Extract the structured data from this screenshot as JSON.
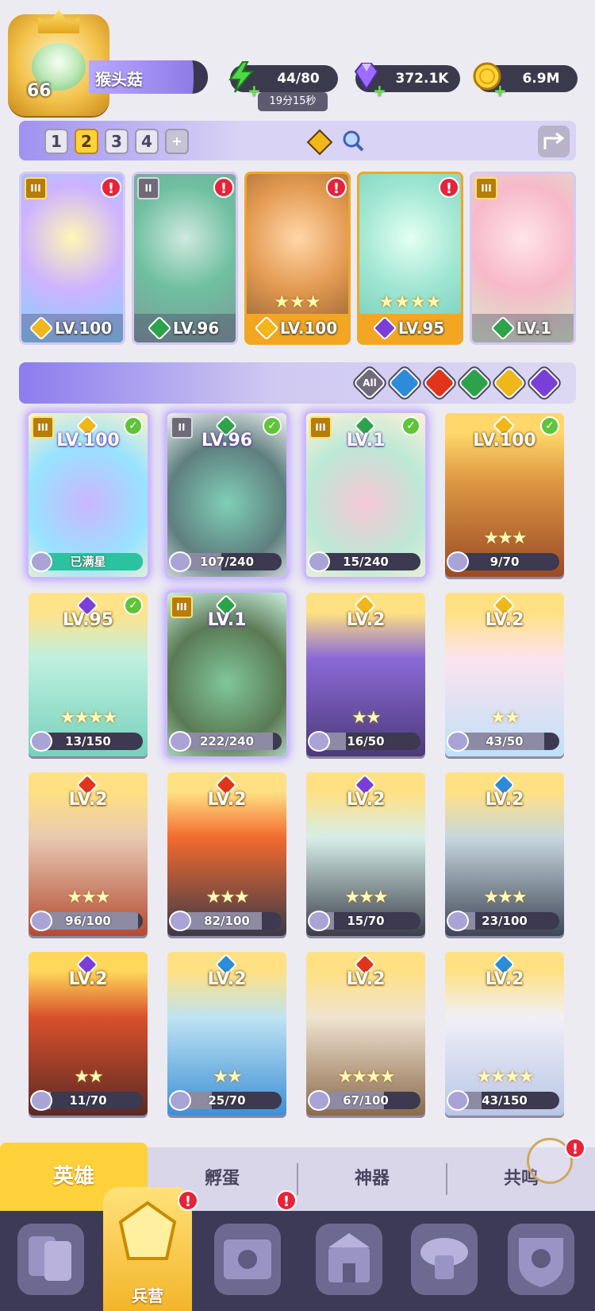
{
  "player": {
    "level": "66",
    "name": "猴头菇"
  },
  "resources": {
    "energy": "44/80",
    "energy_timer": "19分15秒",
    "gems": "372.1K",
    "gold": "6.9M"
  },
  "team_tabs": [
    "1",
    "2",
    "3",
    "4",
    "+"
  ],
  "team": [
    {
      "level": "LV.100",
      "element": "light",
      "rank": "III",
      "stars": "",
      "alert": "!",
      "art": [
        "#fff6b6",
        "#cdb3ff",
        "#7fd1ff"
      ]
    },
    {
      "level": "LV.96",
      "element": "wind",
      "rank": "II",
      "stars": "",
      "alert": "!",
      "art": [
        "#cfe9e0",
        "#6fbfa0",
        "#7e9a9a"
      ]
    },
    {
      "level": "LV.100",
      "element": "light",
      "rank": "",
      "stars": "★★★",
      "alert": "!",
      "art": [
        "#ffd7a8",
        "#e39a52",
        "#8a5a2f"
      ]
    },
    {
      "level": "LV.95",
      "element": "dark",
      "rank": "",
      "stars": "★★★★",
      "alert": "!",
      "art": [
        "#e4fff2",
        "#9fe6d2",
        "#6fc9b7"
      ]
    },
    {
      "level": "LV.1",
      "element": "wind",
      "rank": "III",
      "stars": "",
      "alert": "",
      "art": [
        "#ffe4ea",
        "#f7b9c9",
        "#d5eec9"
      ]
    }
  ],
  "filters": [
    "All",
    "water",
    "fire",
    "wind",
    "light",
    "dark"
  ],
  "filters_all_label": "All",
  "heroes": [
    {
      "level": "LV.100",
      "element": "light",
      "rank": "III",
      "checked": true,
      "stars": "",
      "progress": "已满星",
      "fill": 1.0,
      "full": true,
      "selected": true,
      "art": [
        "#fff3c7",
        "#cbb6ff",
        "#98e3ff"
      ]
    },
    {
      "level": "LV.96",
      "element": "wind",
      "rank": "II",
      "checked": true,
      "stars": "",
      "progress": "107/240",
      "fill": 0.45,
      "full": false,
      "selected": true,
      "art": [
        "#f2f2f2",
        "#7fcfb6",
        "#5f7f7f"
      ]
    },
    {
      "level": "LV.1",
      "element": "wind",
      "rank": "III",
      "checked": true,
      "stars": "",
      "progress": "15/240",
      "fill": 0.06,
      "full": false,
      "selected": true,
      "art": [
        "#fff0d8",
        "#f7c7d8",
        "#bce9d6"
      ]
    },
    {
      "level": "LV.100",
      "element": "light",
      "rank": "",
      "checked": true,
      "stars": "★★★",
      "progress": "9/70",
      "fill": 0.13,
      "full": false,
      "selected": false,
      "art": [
        "#ffd76a",
        "#e09a45",
        "#9a4a25"
      ]
    },
    {
      "level": "LV.95",
      "element": "dark",
      "rank": "",
      "checked": true,
      "stars": "★★★★",
      "progress": "13/150",
      "fill": 0.09,
      "full": false,
      "selected": false,
      "art": [
        "#ffe38a",
        "#bff0df",
        "#76d1bc"
      ]
    },
    {
      "level": "LV.1",
      "element": "wind",
      "rank": "III",
      "checked": false,
      "stars": "",
      "progress": "222/240",
      "fill": 0.92,
      "full": false,
      "selected": true,
      "art": [
        "#c9f1e0",
        "#7fc79a",
        "#5b7a54"
      ]
    },
    {
      "level": "LV.2",
      "element": "light",
      "rank": "",
      "checked": false,
      "stars": "★★",
      "progress": "16/50",
      "fill": 0.32,
      "full": false,
      "selected": false,
      "art": [
        "#ffe184",
        "#8b6ad6",
        "#4b3a7a"
      ]
    },
    {
      "level": "LV.2",
      "element": "light",
      "rank": "",
      "checked": false,
      "stars": "★★",
      "progress": "43/50",
      "fill": 0.86,
      "full": false,
      "selected": false,
      "art": [
        "#ffe184",
        "#fde3ef",
        "#bfe0f7"
      ]
    },
    {
      "level": "LV.2",
      "element": "fire",
      "rank": "",
      "checked": false,
      "stars": "★★★",
      "progress": "96/100",
      "fill": 0.96,
      "full": false,
      "selected": false,
      "art": [
        "#ffe184",
        "#e8c9b0",
        "#b44a34"
      ]
    },
    {
      "level": "LV.2",
      "element": "fire",
      "rank": "",
      "checked": false,
      "stars": "★★★",
      "progress": "82/100",
      "fill": 0.82,
      "full": false,
      "selected": false,
      "art": [
        "#ffe184",
        "#f26a2e",
        "#3a3a4a"
      ]
    },
    {
      "level": "LV.2",
      "element": "dark",
      "rank": "",
      "checked": false,
      "stars": "★★★",
      "progress": "15/70",
      "fill": 0.21,
      "full": false,
      "selected": false,
      "art": [
        "#ffe184",
        "#d6eee8",
        "#3a3d4a"
      ]
    },
    {
      "level": "LV.2",
      "element": "water",
      "rank": "",
      "checked": false,
      "stars": "★★★",
      "progress": "23/100",
      "fill": 0.23,
      "full": false,
      "selected": false,
      "art": [
        "#ffe184",
        "#c7d6de",
        "#3e4656"
      ]
    },
    {
      "level": "LV.2",
      "element": "dark",
      "rank": "",
      "checked": false,
      "stars": "★★",
      "progress": "11/70",
      "fill": 0.16,
      "full": false,
      "selected": false,
      "art": [
        "#ffd75a",
        "#d9502c",
        "#5a2a24"
      ]
    },
    {
      "level": "LV.2",
      "element": "water",
      "rank": "",
      "checked": false,
      "stars": "★★",
      "progress": "25/70",
      "fill": 0.36,
      "full": false,
      "selected": false,
      "art": [
        "#ffe184",
        "#bfe3f2",
        "#3c8fd6"
      ]
    },
    {
      "level": "LV.2",
      "element": "fire",
      "rank": "",
      "checked": false,
      "stars": "★★★★",
      "progress": "67/100",
      "fill": 0.67,
      "full": false,
      "selected": false,
      "art": [
        "#ffe184",
        "#f0e3d0",
        "#8a6a4a"
      ]
    },
    {
      "level": "LV.2",
      "element": "water",
      "rank": "",
      "checked": false,
      "stars": "★★★★",
      "progress": "43/150",
      "fill": 0.29,
      "full": false,
      "selected": false,
      "art": [
        "#ffe184",
        "#f0f0f7",
        "#b8c6e6"
      ]
    }
  ],
  "sub_tabs": {
    "heroes": "英雄",
    "hatch": "孵蛋",
    "artifact": "神器",
    "resonance": "共鸣"
  },
  "nav": {
    "barracks": "兵营"
  },
  "alert_mark": "!",
  "colors": {
    "light": "#f0b61a",
    "wind": "#2ca34a",
    "dark": "#7a3fd6",
    "fire": "#e0341c",
    "water": "#2d8bd8",
    "accent": "#ffd23c",
    "purple_bar": "#9f91f0"
  }
}
